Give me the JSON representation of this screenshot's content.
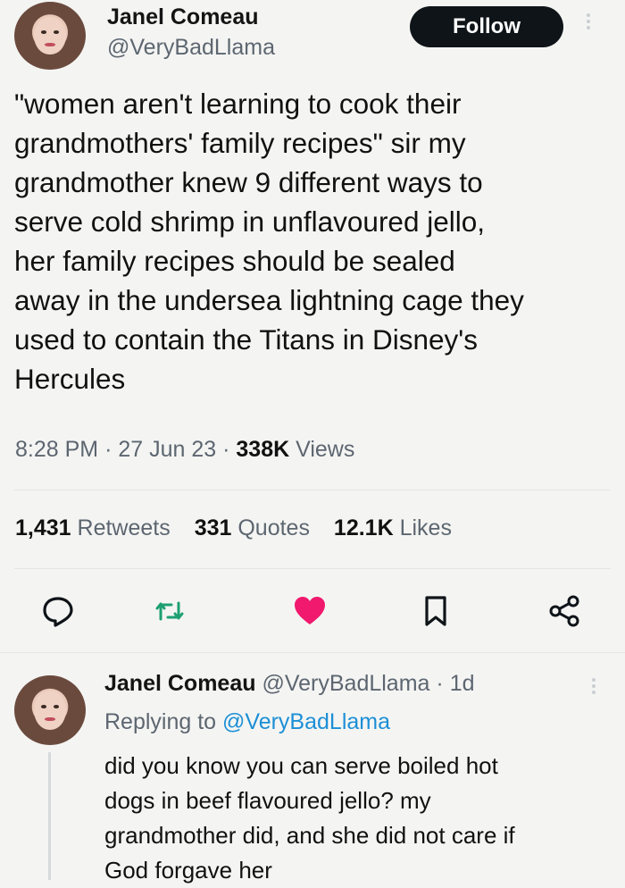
{
  "tweet": {
    "author_name": "Janel Comeau",
    "author_handle": "@VeryBadLlama",
    "follow_label": "Follow",
    "text": "\"women aren't learning to cook their\ngrandmothers' family recipes\" sir my\ngrandmother knew 9 different ways to\nserve cold shrimp in unflavoured jello,\nher family recipes should be sealed\naway in the undersea lightning cage they\nused to contain the Titans in Disney's\nHercules",
    "time": "8:28 PM",
    "date": "27 Jun 23",
    "views_count": "338K",
    "views_label": "Views",
    "retweets_count": "1,431",
    "retweets_label": "Retweets",
    "quotes_count": "331",
    "quotes_label": "Quotes",
    "likes_count": "12.1K",
    "likes_label": "Likes",
    "liked": true,
    "icons": [
      "reply-icon",
      "retweet-icon",
      "like-icon",
      "bookmark-icon",
      "share-icon"
    ]
  },
  "reply": {
    "author_name": "Janel Comeau",
    "author_handle": "@VeryBadLlama",
    "age": "1d",
    "replying_prefix": "Replying to",
    "replying_handle": "@VeryBadLlama",
    "text": "did you know you can serve boiled hot\ndogs in beef flavoured jello? my\ngrandmother did, and she did not care if\nGod forgave her"
  },
  "colors": {
    "background": "#f4f5f3",
    "button": "#0f1419",
    "like": "#f0196e",
    "retweet": "#1d9f73",
    "link": "#1d8fd6",
    "secondary_text": "#5d6670"
  }
}
